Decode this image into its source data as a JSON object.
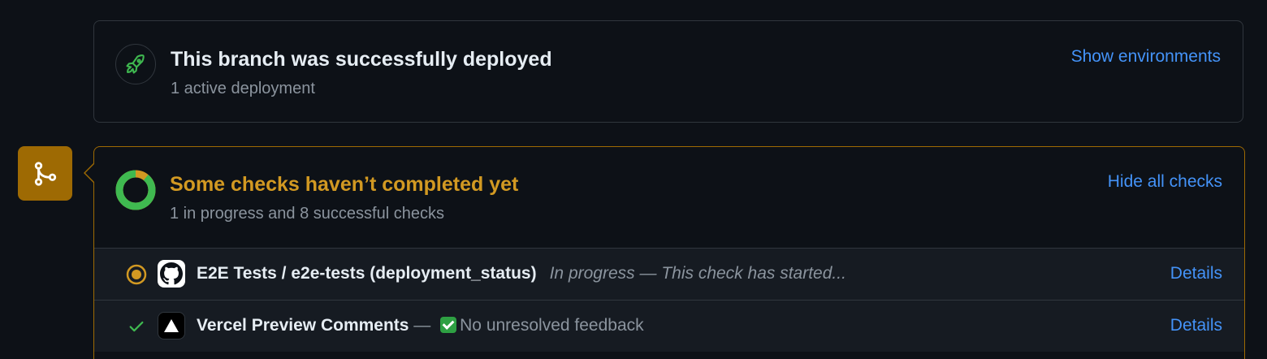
{
  "deployment": {
    "title": "This branch was successfully deployed",
    "subtitle": "1 active deployment",
    "action_label": "Show environments",
    "icon": "rocket-icon"
  },
  "checks": {
    "title": "Some checks haven’t completed yet",
    "subtitle": "1 in progress and 8 successful checks",
    "action_label": "Hide all checks",
    "progress_completed_fraction": 0.89,
    "badge_icon": "git-merge-icon",
    "rows": [
      {
        "status": "in-progress",
        "app_icon": "github-icon",
        "name": "E2E Tests / e2e-tests (deployment_status)",
        "description": "In progress — This check has started...",
        "details_label": "Details"
      },
      {
        "status": "success",
        "app_icon": "vercel-icon",
        "name": "Vercel Preview Comments",
        "separator": " — ",
        "description": "No unresolved feedback",
        "details_label": "Details"
      }
    ]
  },
  "colors": {
    "background": "#0d1117",
    "border": "#30363d",
    "accent_link": "#4493f8",
    "pending": "#d29922",
    "success": "#3fb950",
    "muted_text": "#8b949e"
  }
}
